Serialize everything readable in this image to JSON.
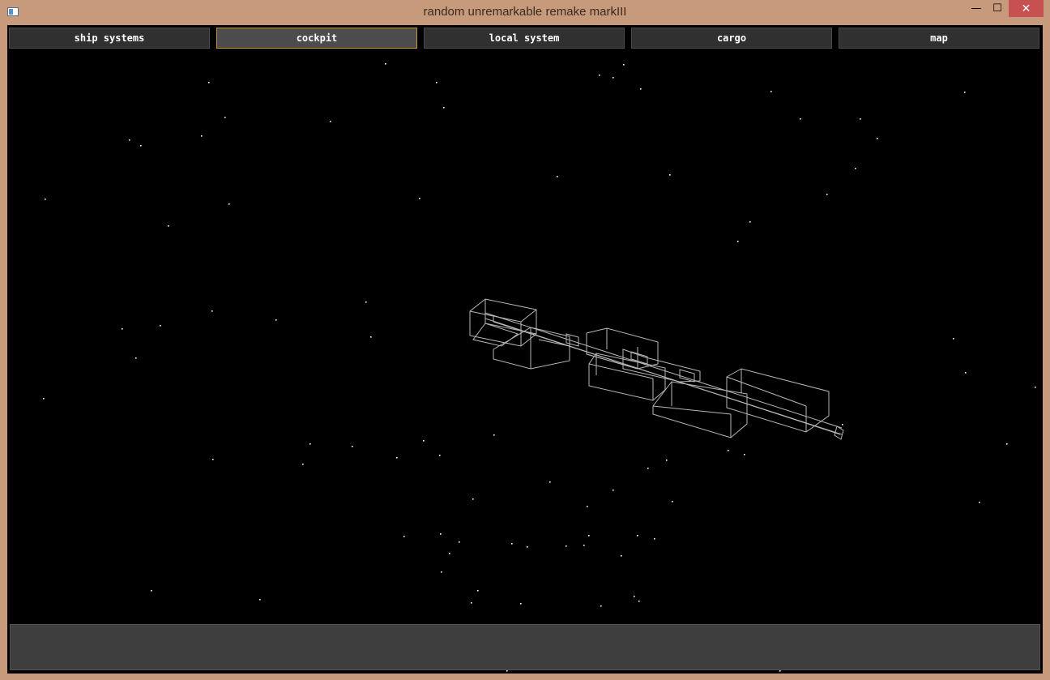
{
  "window": {
    "title": "random unremarkable remake markIII",
    "minimize_glyph": "—",
    "maximize_glyph": "☐",
    "close_glyph": "✕"
  },
  "tabs": [
    {
      "label": "ship systems",
      "active": false
    },
    {
      "label": "cockpit",
      "active": true
    },
    {
      "label": "local system",
      "active": false
    },
    {
      "label": "cargo",
      "active": false
    },
    {
      "label": "map",
      "active": false
    }
  ],
  "colors": {
    "frame": "#c69a7b",
    "space": "#000000",
    "tab_active_border": "#c8942a",
    "wireframe": "#d8d8d8"
  },
  "scene": {
    "view": "cockpit",
    "object": "wireframe-ship"
  }
}
